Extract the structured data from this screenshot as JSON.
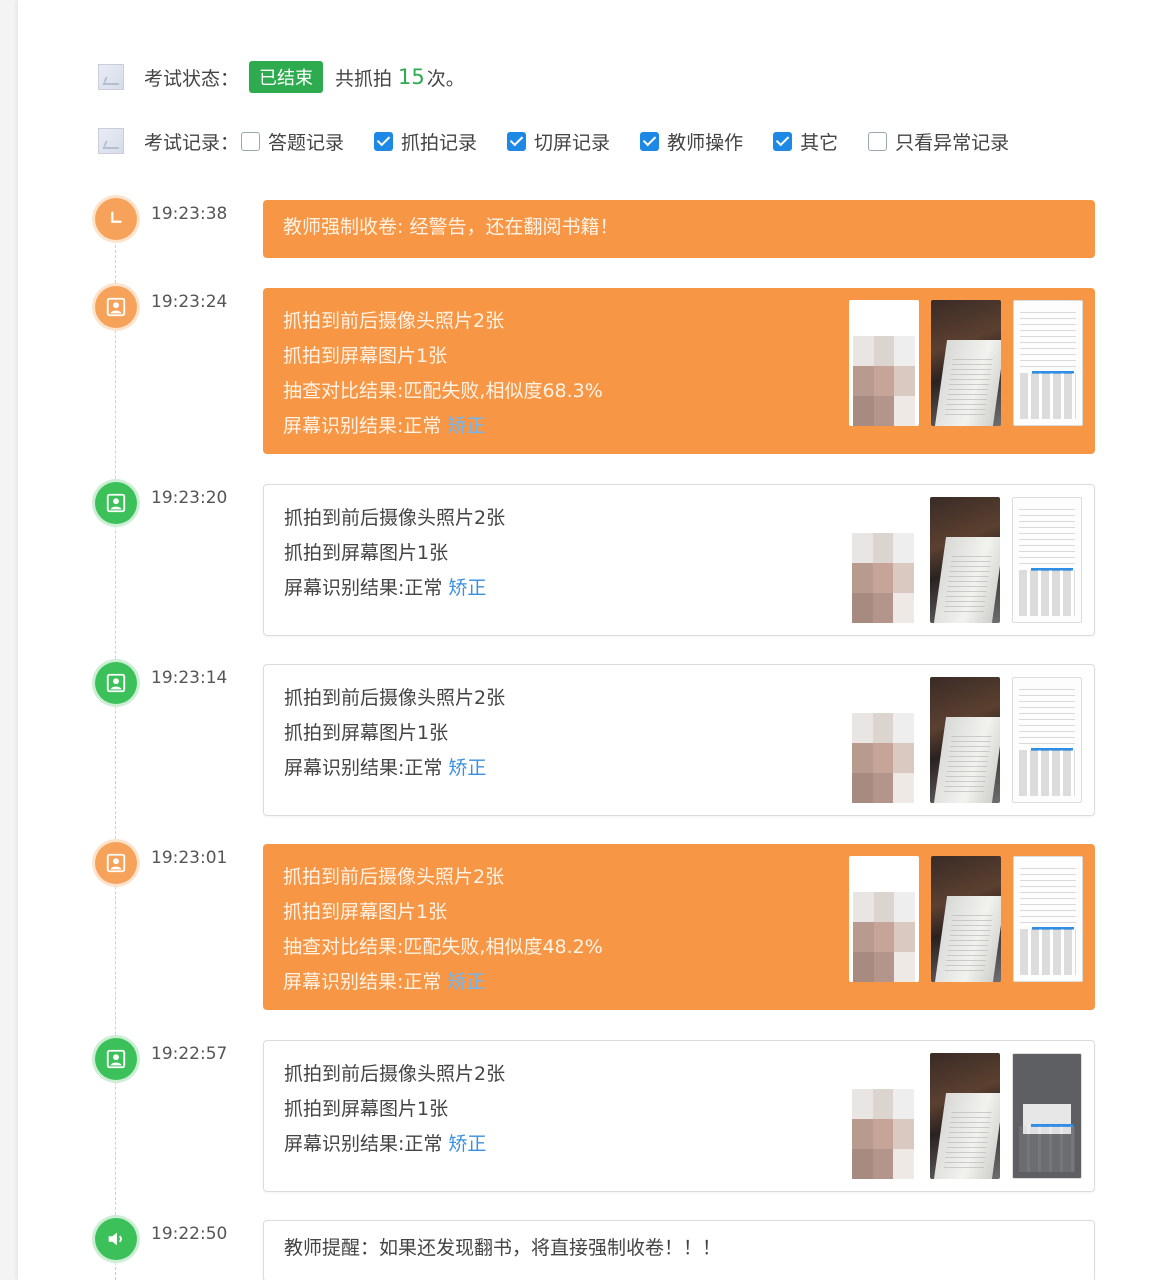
{
  "header": {
    "status_label": "考试状态：",
    "status_badge": "已结束",
    "count_prefix": "共抓拍",
    "count_value": "15",
    "count_suffix": "次。",
    "records_label": "考试记录：",
    "filters": [
      {
        "label": "答题记录",
        "checked": false
      },
      {
        "label": "抓拍记录",
        "checked": true
      },
      {
        "label": "切屏记录",
        "checked": true
      },
      {
        "label": "教师操作",
        "checked": true
      },
      {
        "label": "其它",
        "checked": true
      },
      {
        "label": "只看异常记录",
        "checked": false
      }
    ]
  },
  "entries": [
    {
      "time": "19:23:38",
      "icon": "clock-icon",
      "style": "orange",
      "lines": [
        "教师强制收卷: 经警告，还在翻阅书籍！"
      ],
      "fix": ""
    },
    {
      "time": "19:23:24",
      "icon": "face-capture-icon",
      "style": "orange",
      "lines": [
        "抓拍到前后摄像头照片2张",
        "抓拍到屏幕图片1张",
        "抽查对比结果:匹配失败,相似度68.3%",
        "屏幕识别结果:正常"
      ],
      "fix": "矫正"
    },
    {
      "time": "19:23:20",
      "icon": "face-capture-icon",
      "style": "white",
      "lines": [
        "抓拍到前后摄像头照片2张",
        "抓拍到屏幕图片1张",
        "屏幕识别结果:正常"
      ],
      "fix": "矫正"
    },
    {
      "time": "19:23:14",
      "icon": "face-capture-icon",
      "style": "white",
      "lines": [
        "抓拍到前后摄像头照片2张",
        "抓拍到屏幕图片1张",
        "屏幕识别结果:正常"
      ],
      "fix": "矫正"
    },
    {
      "time": "19:23:01",
      "icon": "face-capture-icon",
      "style": "orange",
      "lines": [
        "抓拍到前后摄像头照片2张",
        "抓拍到屏幕图片1张",
        "抽查对比结果:匹配失败,相似度48.2%",
        "屏幕识别结果:正常"
      ],
      "fix": "矫正"
    },
    {
      "time": "19:22:57",
      "icon": "face-capture-icon",
      "style": "white",
      "lines": [
        "抓拍到前后摄像头照片2张",
        "抓拍到屏幕图片1张",
        "屏幕识别结果:正常"
      ],
      "fix": "矫正"
    },
    {
      "time": "19:22:50",
      "icon": "speaker-icon",
      "style": "white",
      "lines": [
        "教师提醒：如果还发现翻书，将直接强制收卷！！！"
      ],
      "fix": ""
    }
  ],
  "colors": {
    "accent_orange": "#f79645",
    "accent_green": "#2eab4f",
    "link_blue": "#3a8fe0",
    "checkbox_blue": "#1e88e5"
  }
}
